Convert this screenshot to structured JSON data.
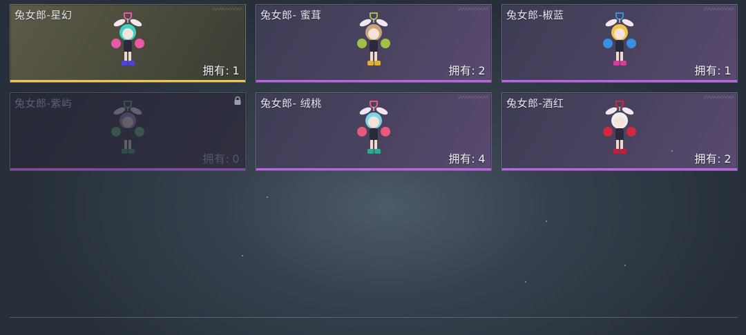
{
  "owned_label": "拥有:",
  "cards": [
    {
      "title": "兔女郎-星幻",
      "count": "1",
      "rarity": "gold",
      "locked": false,
      "colors": {
        "hair": "#3fd0c8",
        "accent": "#e65aa8",
        "boots": "#4a44d8"
      }
    },
    {
      "title": "兔女郎- 蜜茸",
      "count": "2",
      "rarity": "purple",
      "locked": false,
      "colors": {
        "hair": "#c9a47a",
        "accent": "#a0c048",
        "boots": "#d8b03a"
      }
    },
    {
      "title": "兔女郎-椒蓝",
      "count": "1",
      "rarity": "purple",
      "locked": false,
      "colors": {
        "hair": "#f0c44a",
        "accent": "#3a8fe0",
        "boots": "#d0409a"
      }
    },
    {
      "title": "兔女郎-紫屿",
      "count": "0",
      "rarity": "purple",
      "locked": true,
      "colors": {
        "hair": "#9a80c0",
        "accent": "#58c070",
        "boots": "#3fa070"
      }
    },
    {
      "title": "兔女郎- 绒桃",
      "count": "4",
      "rarity": "purple",
      "locked": false,
      "colors": {
        "hair": "#7fd6e0",
        "accent": "#e85a7a",
        "boots": "#30a890"
      }
    },
    {
      "title": "兔女郎-酒红",
      "count": "2",
      "rarity": "purple",
      "locked": false,
      "colors": {
        "hair": "#eeeeee",
        "accent": "#d02840",
        "boots": "#c02040"
      }
    }
  ]
}
